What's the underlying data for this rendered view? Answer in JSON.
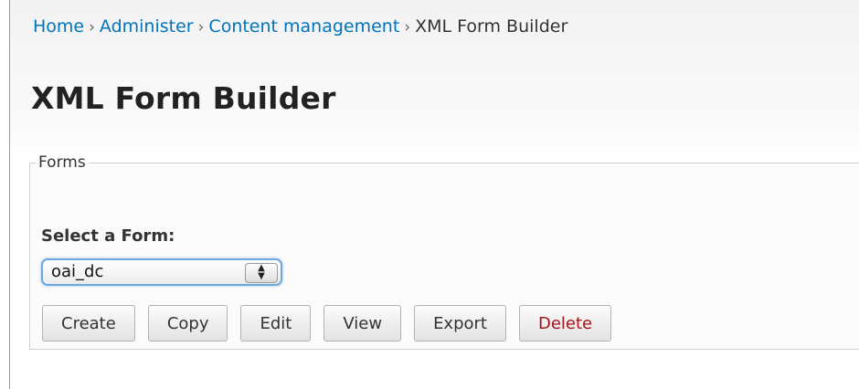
{
  "breadcrumb": {
    "items": [
      "Home",
      "Administer",
      "Content management"
    ],
    "separator": "›",
    "current": "XML Form Builder"
  },
  "page": {
    "title": "XML Form Builder"
  },
  "forms_fieldset": {
    "legend": "Forms",
    "select_label": "Select a Form:",
    "selected_value": "oai_dc"
  },
  "buttons": {
    "create": "Create",
    "copy": "Copy",
    "edit": "Edit",
    "view": "View",
    "export": "Export",
    "delete": "Delete"
  },
  "colors": {
    "link": "#0074bd",
    "delete_text": "#a5141a",
    "focus_ring": "#6ea6de"
  }
}
